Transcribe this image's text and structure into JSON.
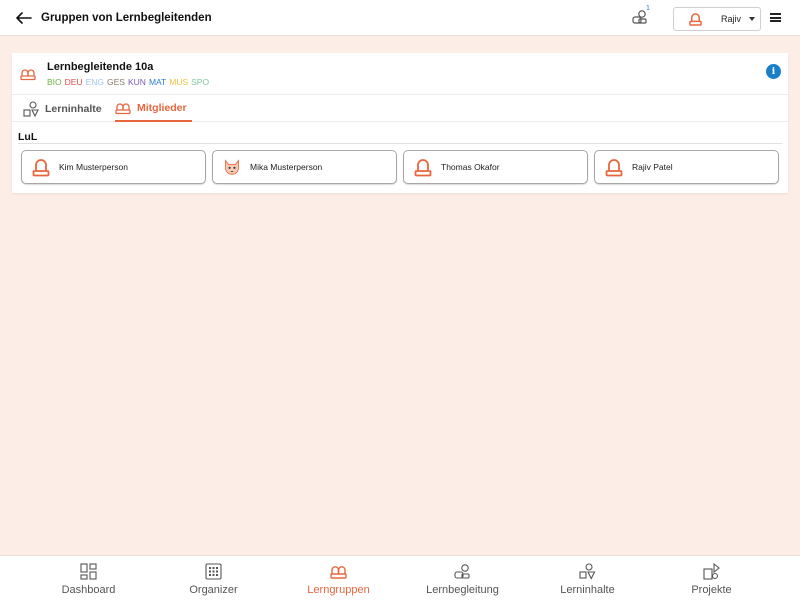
{
  "header": {
    "title": "Gruppen von Lernbegleitenden",
    "notification_count": "1",
    "user_name": "Rajiv"
  },
  "group": {
    "name": "Lernbegleitende 10a",
    "subjects": [
      {
        "code": "BIO",
        "color": "#6db33f"
      },
      {
        "code": "DEU",
        "color": "#e04b4b"
      },
      {
        "code": "ENG",
        "color": "#9ec5e8"
      },
      {
        "code": "GES",
        "color": "#8a7a6a"
      },
      {
        "code": "KUN",
        "color": "#7b57b5"
      },
      {
        "code": "MAT",
        "color": "#2e7fd0"
      },
      {
        "code": "MUS",
        "color": "#f0c23b"
      },
      {
        "code": "SPO",
        "color": "#7cc8a0"
      }
    ]
  },
  "tabs": {
    "content_label": "Lerninhalte",
    "members_label": "Mitglieder"
  },
  "section": {
    "label": "LuL"
  },
  "members": [
    {
      "name": "Kim Musterperson",
      "avatar": "person-icon"
    },
    {
      "name": "Mika Musterperson",
      "avatar": "cat-avatar-icon"
    },
    {
      "name": "Thomas Okafor",
      "avatar": "person-icon"
    },
    {
      "name": "Rajiv Patel",
      "avatar": "person-icon"
    }
  ],
  "nav": {
    "dashboard": "Dashboard",
    "organizer": "Organizer",
    "lerngruppen": "Lerngruppen",
    "lernbegleitung": "Lernbegleitung",
    "lerninhalte": "Lerninhalte",
    "projekte": "Projekte"
  },
  "colors": {
    "accent": "#e8663d",
    "background": "#fcede7",
    "info": "#1a7fc9"
  }
}
